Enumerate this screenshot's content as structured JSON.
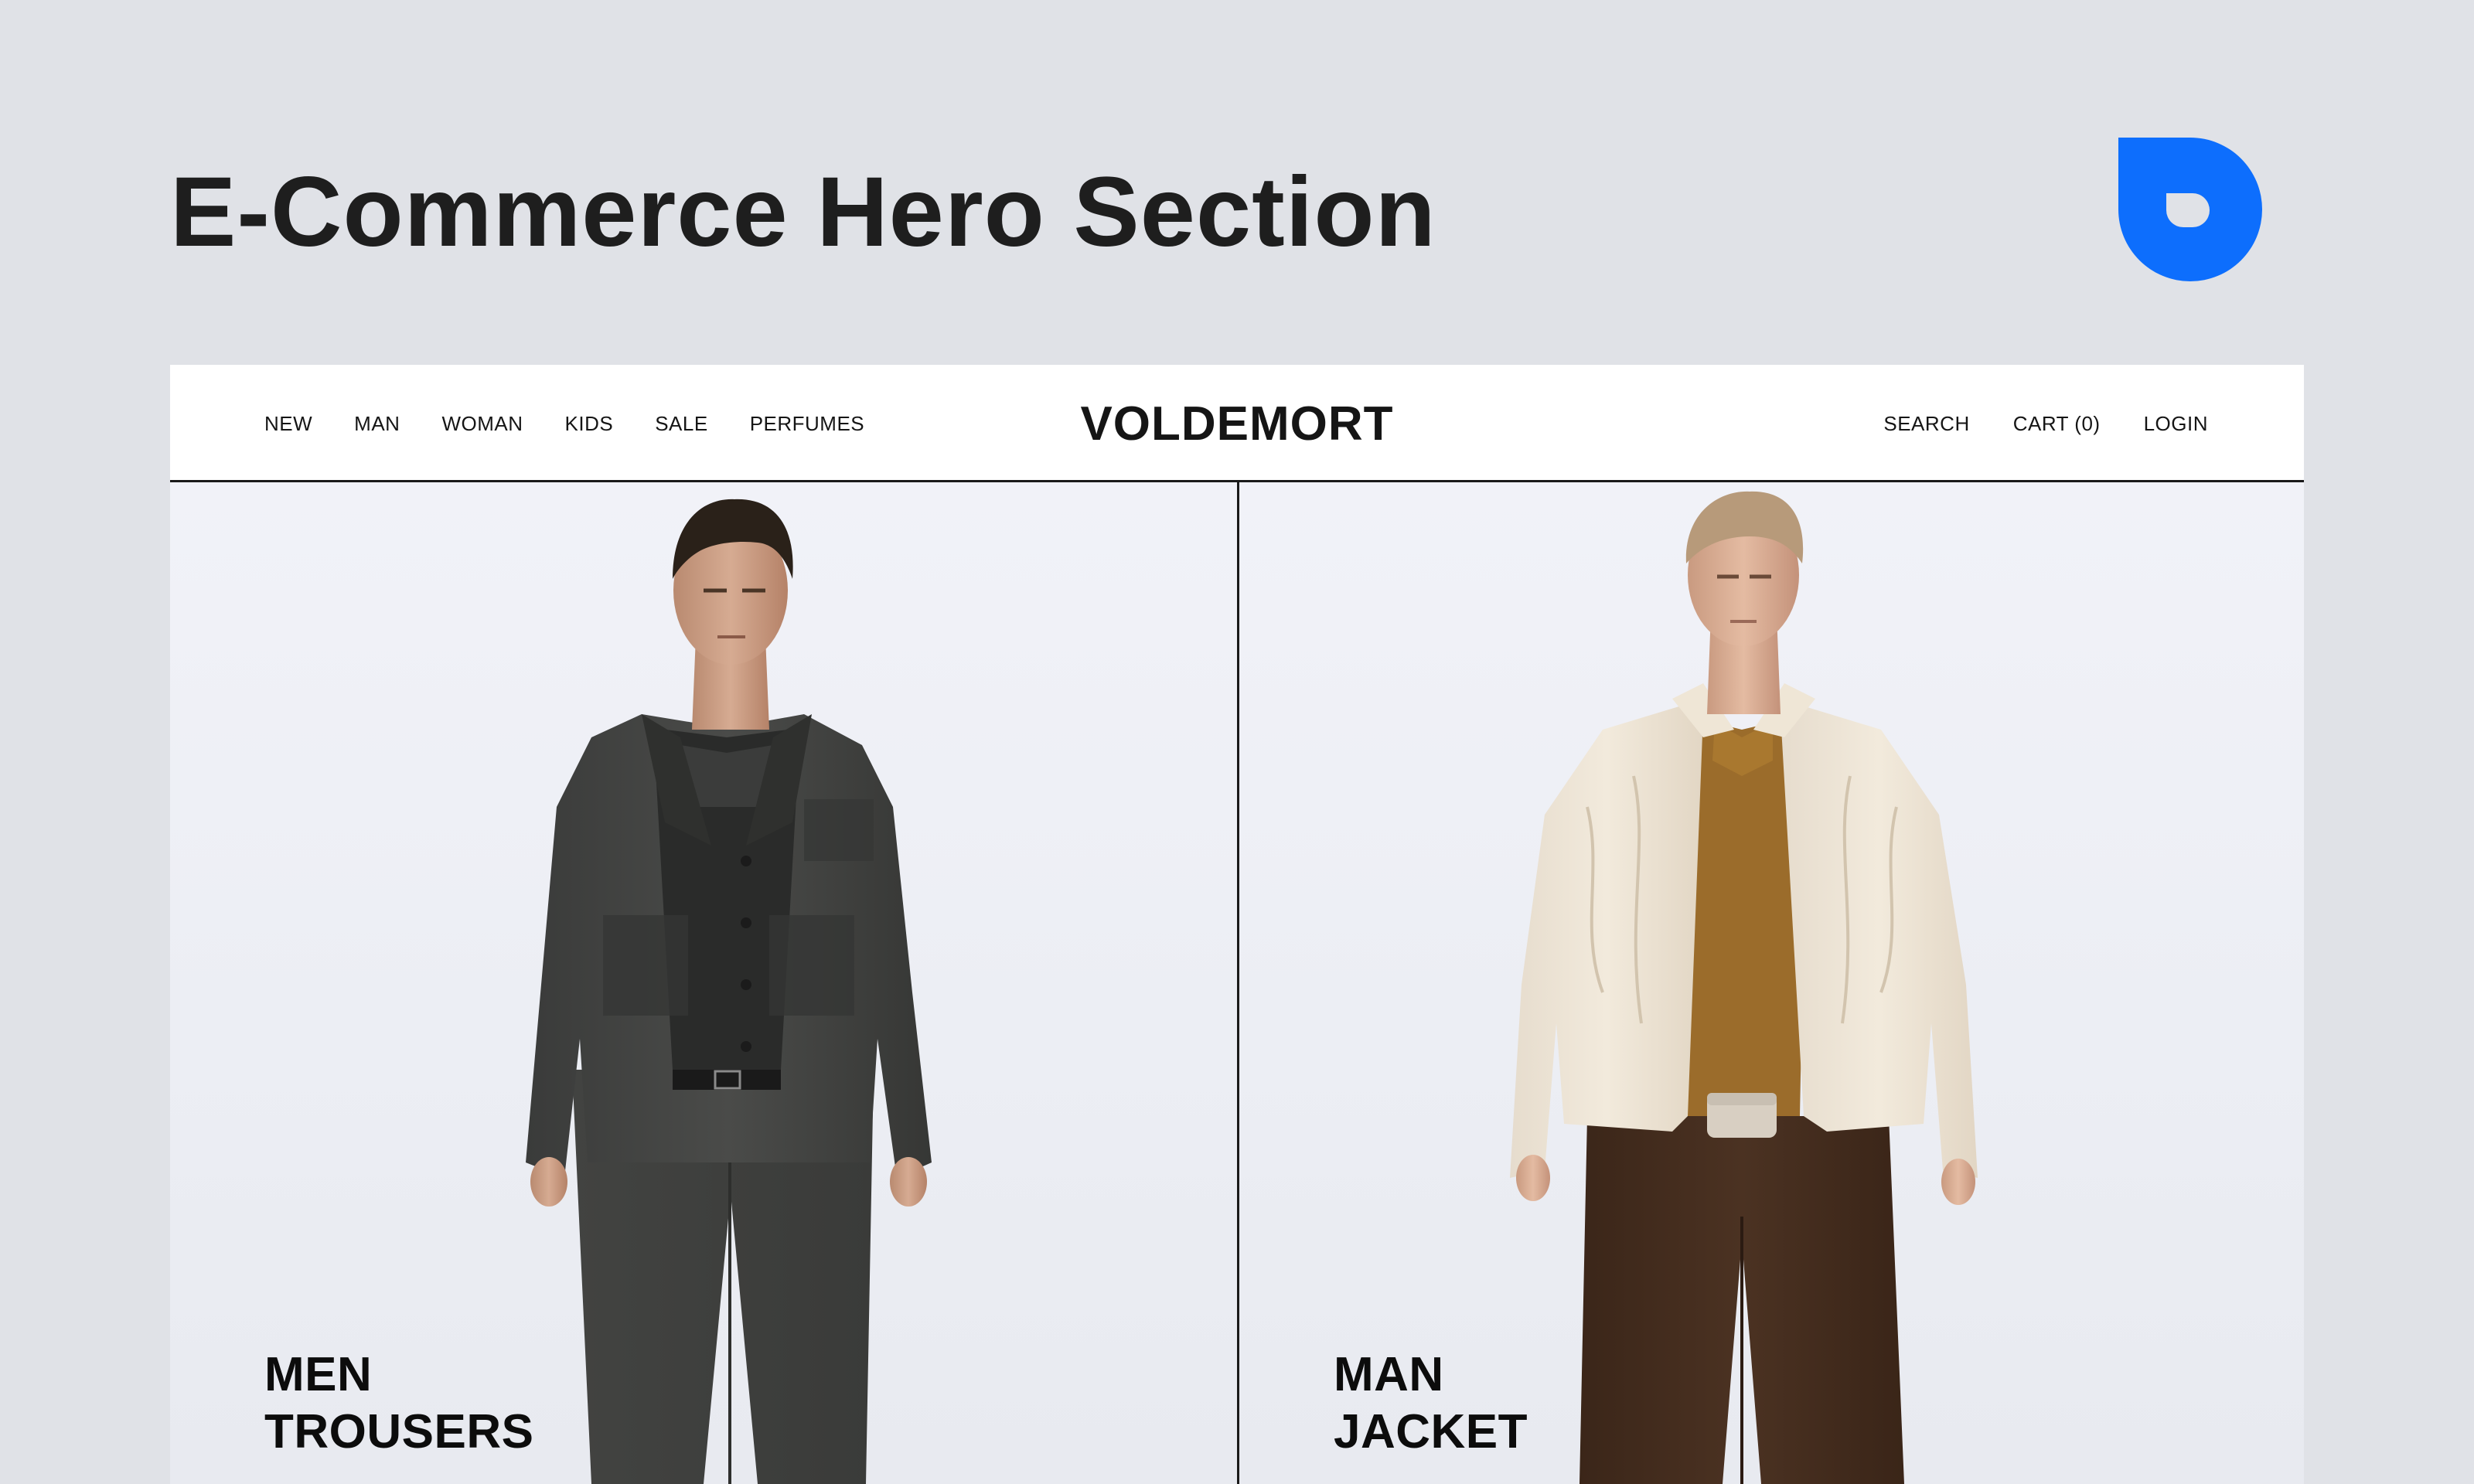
{
  "page": {
    "title": "E-Commerce Hero Section",
    "background": "#e0e2e7",
    "brand_mark_icon": "brand-logo-icon",
    "brand_color": "#0d6efd"
  },
  "header": {
    "nav_left": [
      "NEW",
      "MAN",
      "WOMAN",
      "KIDS",
      "SALE",
      "PERFUMES"
    ],
    "logo": "VOLDEMORT",
    "nav_right": [
      "SEARCH",
      "CART (0)",
      "LOGIN"
    ]
  },
  "hero": {
    "panels": [
      {
        "line1": "MEN",
        "line2": "TROUSERS",
        "image": "model-in-charcoal-linen-jacket-and-trousers"
      },
      {
        "line1": "MAN",
        "line2": "JACKET",
        "image": "model-in-cream-textured-jacket-and-brown-trousers"
      }
    ]
  },
  "colors": {
    "text": "#111111",
    "divider": "#1a1a1a",
    "panel_bg": "#eef0f6"
  }
}
